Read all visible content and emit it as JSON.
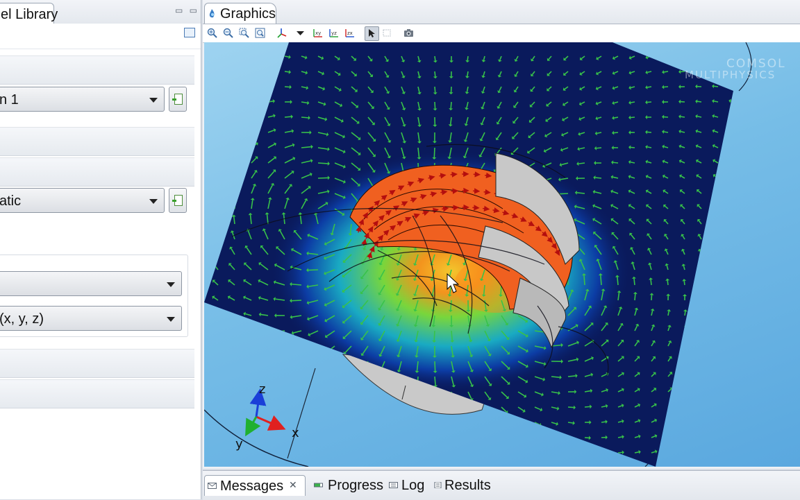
{
  "left_panel": {
    "tab_label": "el Library",
    "window_buttons": "▭ ▭",
    "combo_1": "n 1",
    "combo_2": "atic",
    "combo_3": "",
    "combo_4": "(x, y, z)"
  },
  "graphics": {
    "tab_label": "Graphics",
    "watermark_line1": "COMSOL",
    "watermark_line2": "MULTIPHYSICS",
    "axes": {
      "x": "x",
      "y": "y",
      "z": "z"
    },
    "toolbar_tools": [
      "zoom-in-icon",
      "zoom-out-icon",
      "zoom-box-icon",
      "zoom-extents-icon",
      "axis-orientation-icon",
      "dropdown-arrow-icon",
      "view-xy-icon",
      "view-yz-icon",
      "view-zx-icon",
      "select-icon",
      "select-box-icon",
      "camera-icon"
    ],
    "colors": {
      "background": "#76bde7",
      "plot_surface": "#0a1a5c",
      "coil": "#f06020",
      "arrow": "#38c24a",
      "gray_boundary": "#c8c8c8"
    }
  },
  "bottom_tabs": {
    "messages": "Messages",
    "progress": "Progress",
    "log": "Log",
    "results": "Results"
  }
}
